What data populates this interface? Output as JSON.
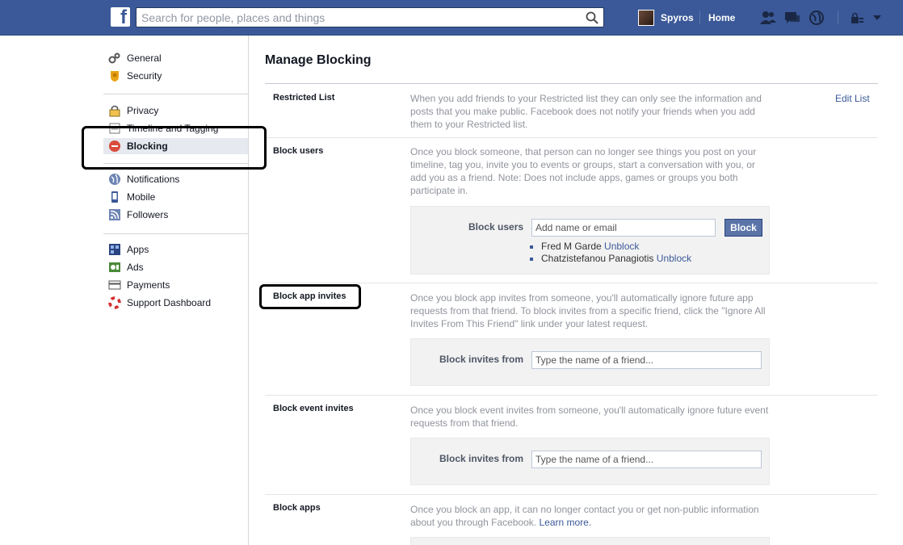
{
  "topbar": {
    "logo": "f",
    "search_placeholder": "Search for people, places and things",
    "profile_name": "Spyros",
    "home_label": "Home",
    "icons": [
      "friend-requests-icon",
      "messages-icon",
      "notifications-globe-icon",
      "privacy-shortcuts-icon",
      "account-menu-arrow-icon"
    ]
  },
  "sidebar": {
    "items": [
      {
        "label": "General",
        "icon": "gears-icon"
      },
      {
        "label": "Security",
        "icon": "badge-icon"
      },
      {
        "label": "Privacy",
        "icon": "lock-icon"
      },
      {
        "label": "Timeline and Tagging",
        "icon": "timeline-icon"
      },
      {
        "label": "Blocking",
        "icon": "block-icon"
      },
      {
        "label": "Notifications",
        "icon": "globe-icon"
      },
      {
        "label": "Mobile",
        "icon": "phone-icon"
      },
      {
        "label": "Followers",
        "icon": "rss-icon"
      },
      {
        "label": "Apps",
        "icon": "apps-icon"
      },
      {
        "label": "Ads",
        "icon": "ads-icon"
      },
      {
        "label": "Payments",
        "icon": "credit-card-icon"
      },
      {
        "label": "Support Dashboard",
        "icon": "lifebuoy-icon"
      }
    ]
  },
  "main": {
    "title": "Manage Blocking",
    "restricted": {
      "label": "Restricted List",
      "description": "When you add friends to your Restricted list they can only see the information and posts that you make public. Facebook does not notify your friends when you add them to your Restricted list.",
      "edit_link": "Edit List"
    },
    "block_users": {
      "label": "Block users",
      "description": "Once you block someone, that person can no longer see things you post on your timeline, tag you, invite you to events or groups, start a conversation with you, or add you as a friend. Note: Does not include apps, games or groups you both participate in.",
      "field_label": "Block users",
      "placeholder": "Add name or email",
      "button": "Block",
      "unblock_label": "Unblock",
      "blocked": [
        "Fred M Garde",
        "Chatzistefanou Panagiotis"
      ]
    },
    "block_app_invites": {
      "label": "Block app invites",
      "description": "Once you block app invites from someone, you'll automatically ignore future app requests from that friend. To block invites from a specific friend, click the \"Ignore All Invites From This Friend\" link under your latest request.",
      "field_label": "Block invites from",
      "placeholder": "Type the name of a friend..."
    },
    "block_event_invites": {
      "label": "Block event invites",
      "description": "Once you block event invites from someone, you'll automatically ignore future event requests from that friend.",
      "field_label": "Block invites from",
      "placeholder": "Type the name of a friend..."
    },
    "block_apps": {
      "label": "Block apps",
      "description": "Once you block an app, it can no longer contact you or get non-public information about you through Facebook.",
      "learn_more": "Learn more."
    }
  },
  "colors": {
    "brand_blue": "#3b5998",
    "button_blue": "#5b74a8",
    "active_nav_bg": "#e6e9ef",
    "annotation": "#000000"
  }
}
